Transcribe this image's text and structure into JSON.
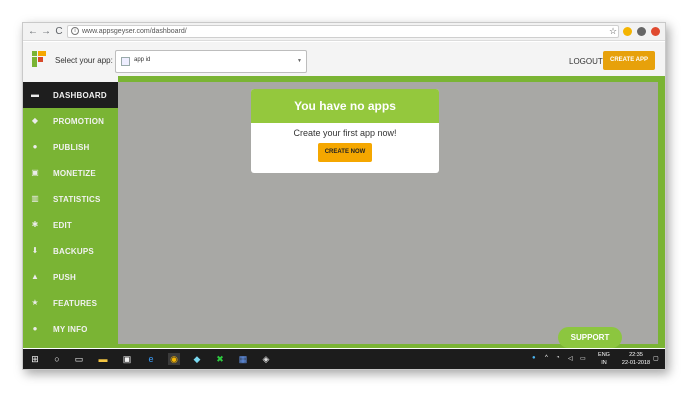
{
  "browser": {
    "url": "www.appsgeyser.com/dashboard/",
    "back_glyph": "←",
    "forward_glyph": "→",
    "reload_glyph": "C"
  },
  "header": {
    "select_label": "Select your app:",
    "selected_app": "app id",
    "logout_label": "LOGOUT",
    "create_app_label": "CREATE APP"
  },
  "sidebar": {
    "items": [
      {
        "label": "DASHBOARD",
        "icon": "briefcase-icon",
        "glyph": "▬"
      },
      {
        "label": "PROMOTION",
        "icon": "promotion-icon",
        "glyph": "◆"
      },
      {
        "label": "PUBLISH",
        "icon": "globe-icon",
        "glyph": "●"
      },
      {
        "label": "MONETIZE",
        "icon": "money-icon",
        "glyph": "▣"
      },
      {
        "label": "STATISTICS",
        "icon": "bar-chart-icon",
        "glyph": "▥"
      },
      {
        "label": "EDIT",
        "icon": "gears-icon",
        "glyph": "✱"
      },
      {
        "label": "BACKUPS",
        "icon": "download-icon",
        "glyph": "⬇"
      },
      {
        "label": "PUSH",
        "icon": "bell-icon",
        "glyph": "▲"
      },
      {
        "label": "FEATURES",
        "icon": "star-icon",
        "glyph": "★"
      },
      {
        "label": "MY INFO",
        "icon": "user-icon",
        "glyph": "●"
      }
    ]
  },
  "card": {
    "title": "You have no apps",
    "subtitle": "Create your first app now!",
    "button_label": "CREATE NOW"
  },
  "support_label": "SUPPORT",
  "taskbar": {
    "lang_line1": "ENG",
    "lang_line2": "IN",
    "time": "22:35",
    "date": "22-01-2018"
  },
  "colors": {
    "sidebar_green": "#7ab434",
    "card_header_green": "#94c83d",
    "accent_orange": "#e7a10b",
    "content_gray": "#a8a8a5"
  }
}
